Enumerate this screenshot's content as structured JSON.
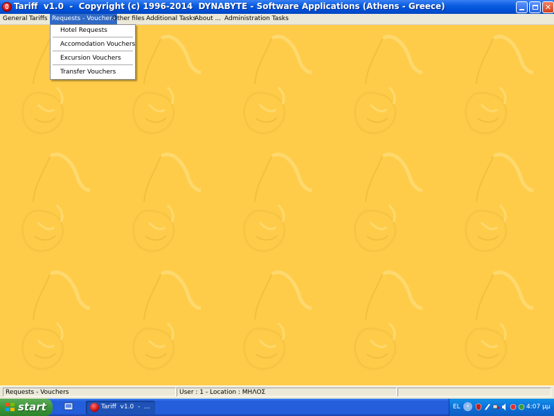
{
  "window": {
    "title": "Tariff  v1.0  -  Copyright (c) 1996-2014  DYNABYTE - Software Applications (Athens - Greece)"
  },
  "menubar": {
    "items": [
      "General",
      "Tariffs",
      "Requests - Vouchers",
      "Other files",
      "Additional Tasks",
      "About ...",
      "Administration Tasks"
    ],
    "active": "Requests - Vouchers"
  },
  "dropdown": {
    "items": [
      "Hotel Requests",
      "Accomodation Vouchers",
      "Excursion Vouchers",
      "Transfer Vouchers"
    ]
  },
  "statusbar": {
    "panel1": "Requests - Vouchers",
    "panel2": "User : 1  -  Location : ΜΗΛΟΣ",
    "panel3": "",
    "panel4": ""
  },
  "taskbar": {
    "start_label": "start",
    "task_label": "Tariff  v1.0  -  ...",
    "language": "EL",
    "clock": "4:07 μμ"
  },
  "colors": {
    "workspace_bg": "#ffcc4a",
    "menu_highlight": "#316ac5",
    "titlebar": "#0a5de0"
  },
  "icons": {
    "app": "tariff-app-icon",
    "minimize": "minimize-icon",
    "maximize": "restore-icon",
    "close": "close-icon",
    "start": "windows-flag-icon"
  }
}
